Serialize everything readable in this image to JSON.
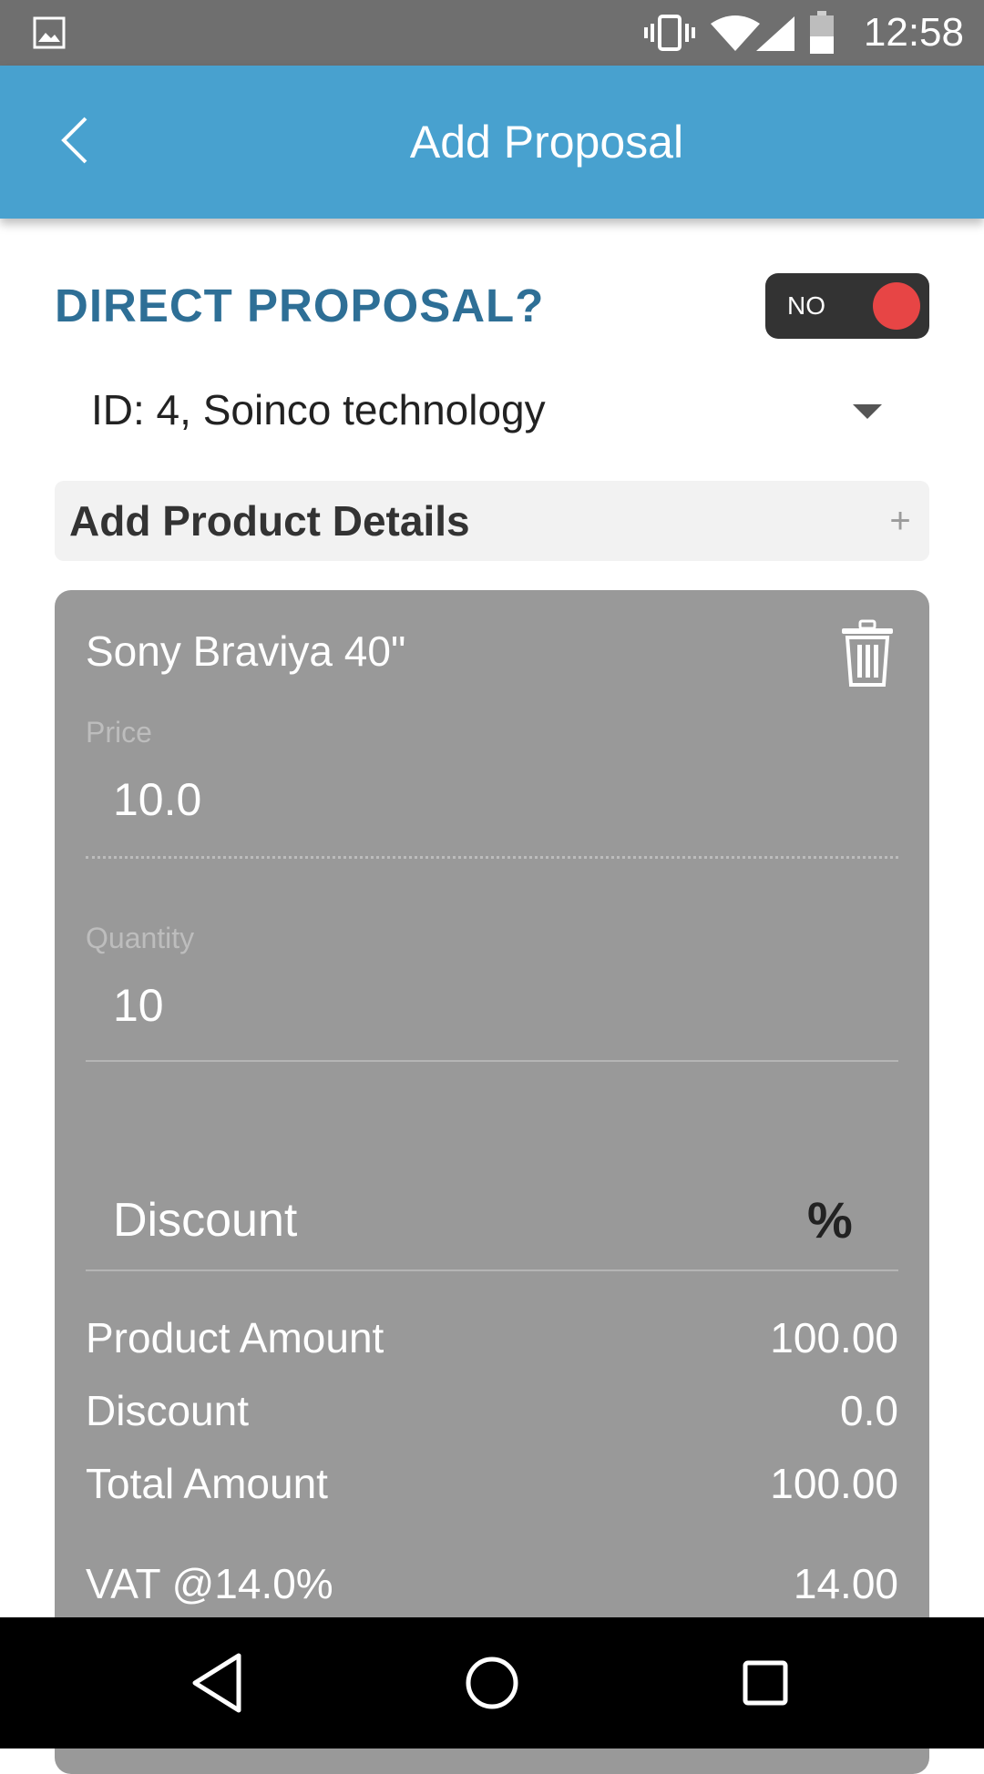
{
  "status_bar": {
    "time": "12:58"
  },
  "app_bar": {
    "title": "Add Proposal"
  },
  "direct_proposal": {
    "label": "DIRECT PROPOSAL?",
    "toggle_value": "NO",
    "toggle_on": false
  },
  "customer": {
    "selected": "ID: 4, Soinco technology"
  },
  "add_product": {
    "label": "Add Product Details"
  },
  "product": {
    "name": "Sony Braviya 40\"",
    "price_label": "Price",
    "price_value": "10.0",
    "quantity_label": "Quantity",
    "quantity_value": "10",
    "discount_placeholder": "Discount",
    "discount_unit": "%",
    "summary": [
      {
        "label": "Product Amount",
        "value": "100.00"
      },
      {
        "label": "Discount",
        "value": "0.0"
      },
      {
        "label": "Total Amount",
        "value": "100.00"
      },
      {
        "label": "VAT @14.0%",
        "value": "14.00"
      }
    ]
  },
  "colors": {
    "app_bar": "#48a1cf",
    "status_bar": "#6f6f6f",
    "direct_label": "#2e6f96",
    "toggle_bg": "#333333",
    "toggle_knob": "#e74545",
    "card_bg": "#999999"
  }
}
